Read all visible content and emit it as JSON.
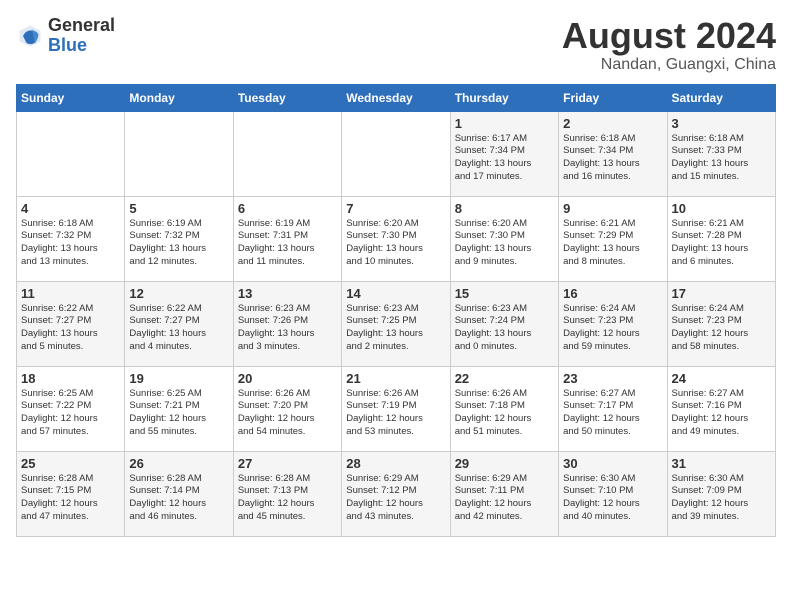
{
  "header": {
    "logo_general": "General",
    "logo_blue": "Blue",
    "month_year": "August 2024",
    "location": "Nandan, Guangxi, China"
  },
  "weekdays": [
    "Sunday",
    "Monday",
    "Tuesday",
    "Wednesday",
    "Thursday",
    "Friday",
    "Saturday"
  ],
  "weeks": [
    [
      {
        "day": "",
        "info": ""
      },
      {
        "day": "",
        "info": ""
      },
      {
        "day": "",
        "info": ""
      },
      {
        "day": "",
        "info": ""
      },
      {
        "day": "1",
        "info": "Sunrise: 6:17 AM\nSunset: 7:34 PM\nDaylight: 13 hours\nand 17 minutes."
      },
      {
        "day": "2",
        "info": "Sunrise: 6:18 AM\nSunset: 7:34 PM\nDaylight: 13 hours\nand 16 minutes."
      },
      {
        "day": "3",
        "info": "Sunrise: 6:18 AM\nSunset: 7:33 PM\nDaylight: 13 hours\nand 15 minutes."
      }
    ],
    [
      {
        "day": "4",
        "info": "Sunrise: 6:18 AM\nSunset: 7:32 PM\nDaylight: 13 hours\nand 13 minutes."
      },
      {
        "day": "5",
        "info": "Sunrise: 6:19 AM\nSunset: 7:32 PM\nDaylight: 13 hours\nand 12 minutes."
      },
      {
        "day": "6",
        "info": "Sunrise: 6:19 AM\nSunset: 7:31 PM\nDaylight: 13 hours\nand 11 minutes."
      },
      {
        "day": "7",
        "info": "Sunrise: 6:20 AM\nSunset: 7:30 PM\nDaylight: 13 hours\nand 10 minutes."
      },
      {
        "day": "8",
        "info": "Sunrise: 6:20 AM\nSunset: 7:30 PM\nDaylight: 13 hours\nand 9 minutes."
      },
      {
        "day": "9",
        "info": "Sunrise: 6:21 AM\nSunset: 7:29 PM\nDaylight: 13 hours\nand 8 minutes."
      },
      {
        "day": "10",
        "info": "Sunrise: 6:21 AM\nSunset: 7:28 PM\nDaylight: 13 hours\nand 6 minutes."
      }
    ],
    [
      {
        "day": "11",
        "info": "Sunrise: 6:22 AM\nSunset: 7:27 PM\nDaylight: 13 hours\nand 5 minutes."
      },
      {
        "day": "12",
        "info": "Sunrise: 6:22 AM\nSunset: 7:27 PM\nDaylight: 13 hours\nand 4 minutes."
      },
      {
        "day": "13",
        "info": "Sunrise: 6:23 AM\nSunset: 7:26 PM\nDaylight: 13 hours\nand 3 minutes."
      },
      {
        "day": "14",
        "info": "Sunrise: 6:23 AM\nSunset: 7:25 PM\nDaylight: 13 hours\nand 2 minutes."
      },
      {
        "day": "15",
        "info": "Sunrise: 6:23 AM\nSunset: 7:24 PM\nDaylight: 13 hours\nand 0 minutes."
      },
      {
        "day": "16",
        "info": "Sunrise: 6:24 AM\nSunset: 7:23 PM\nDaylight: 12 hours\nand 59 minutes."
      },
      {
        "day": "17",
        "info": "Sunrise: 6:24 AM\nSunset: 7:23 PM\nDaylight: 12 hours\nand 58 minutes."
      }
    ],
    [
      {
        "day": "18",
        "info": "Sunrise: 6:25 AM\nSunset: 7:22 PM\nDaylight: 12 hours\nand 57 minutes."
      },
      {
        "day": "19",
        "info": "Sunrise: 6:25 AM\nSunset: 7:21 PM\nDaylight: 12 hours\nand 55 minutes."
      },
      {
        "day": "20",
        "info": "Sunrise: 6:26 AM\nSunset: 7:20 PM\nDaylight: 12 hours\nand 54 minutes."
      },
      {
        "day": "21",
        "info": "Sunrise: 6:26 AM\nSunset: 7:19 PM\nDaylight: 12 hours\nand 53 minutes."
      },
      {
        "day": "22",
        "info": "Sunrise: 6:26 AM\nSunset: 7:18 PM\nDaylight: 12 hours\nand 51 minutes."
      },
      {
        "day": "23",
        "info": "Sunrise: 6:27 AM\nSunset: 7:17 PM\nDaylight: 12 hours\nand 50 minutes."
      },
      {
        "day": "24",
        "info": "Sunrise: 6:27 AM\nSunset: 7:16 PM\nDaylight: 12 hours\nand 49 minutes."
      }
    ],
    [
      {
        "day": "25",
        "info": "Sunrise: 6:28 AM\nSunset: 7:15 PM\nDaylight: 12 hours\nand 47 minutes."
      },
      {
        "day": "26",
        "info": "Sunrise: 6:28 AM\nSunset: 7:14 PM\nDaylight: 12 hours\nand 46 minutes."
      },
      {
        "day": "27",
        "info": "Sunrise: 6:28 AM\nSunset: 7:13 PM\nDaylight: 12 hours\nand 45 minutes."
      },
      {
        "day": "28",
        "info": "Sunrise: 6:29 AM\nSunset: 7:12 PM\nDaylight: 12 hours\nand 43 minutes."
      },
      {
        "day": "29",
        "info": "Sunrise: 6:29 AM\nSunset: 7:11 PM\nDaylight: 12 hours\nand 42 minutes."
      },
      {
        "day": "30",
        "info": "Sunrise: 6:30 AM\nSunset: 7:10 PM\nDaylight: 12 hours\nand 40 minutes."
      },
      {
        "day": "31",
        "info": "Sunrise: 6:30 AM\nSunset: 7:09 PM\nDaylight: 12 hours\nand 39 minutes."
      }
    ]
  ]
}
